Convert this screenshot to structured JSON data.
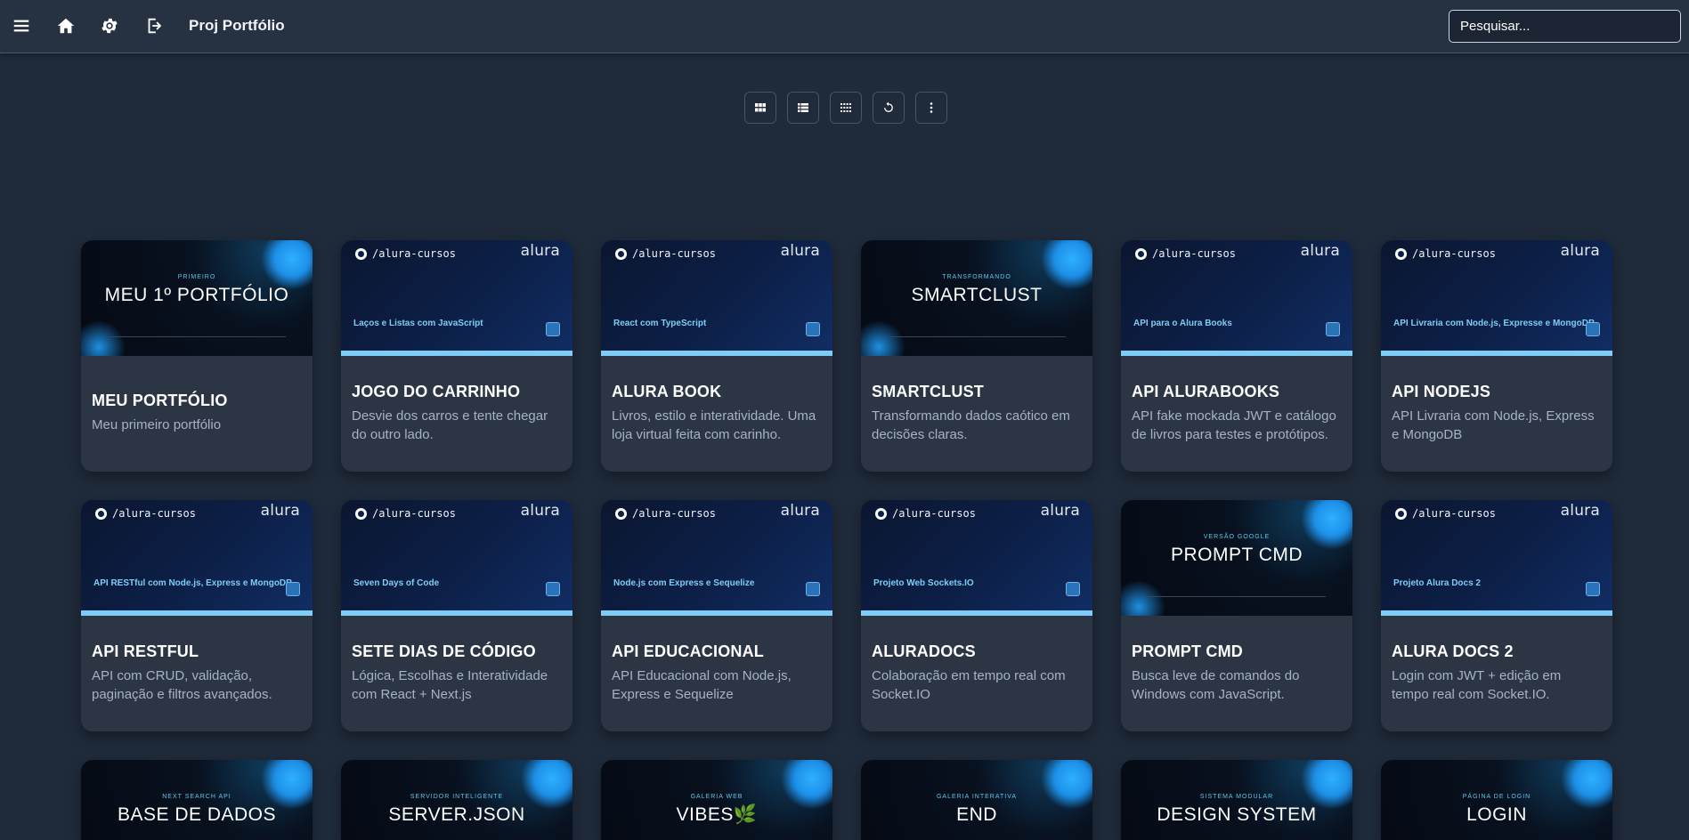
{
  "header": {
    "title": "Proj Portfólio",
    "icons": [
      "menu-icon",
      "home-icon",
      "settings-icon",
      "logout-icon"
    ],
    "search_placeholder": "Pesquisar..."
  },
  "toolbar": {
    "buttons": [
      "grid-view-icon",
      "list-view-icon",
      "compact-grid-icon",
      "refresh-icon",
      "more-options-icon"
    ]
  },
  "colors": {
    "background": "#1f2a3a",
    "card": "#2b3544",
    "accent": "#7ecdf6"
  },
  "cards": [
    {
      "name": "MEU PORTFÓLIO",
      "desc": "Meu primeiro portfólio",
      "thumb": {
        "type": "dark",
        "eyebrow": "PRIMEIRO",
        "title": "MEU 1º PORTFÓLIO"
      }
    },
    {
      "name": "JOGO DO CARRINHO",
      "desc": "Desvie dos carros e tente chegar do outro lado.",
      "thumb": {
        "type": "gh",
        "handle": "/alura-cursos",
        "logo": "alura",
        "course": "Laços e Listas com JavaScript"
      }
    },
    {
      "name": "ALURA BOOK",
      "desc": "Livros, estilo e interatividade. Uma loja virtual feita com carinho.",
      "thumb": {
        "type": "gh",
        "handle": "/alura-cursos",
        "logo": "alura",
        "course": "React com TypeScript"
      }
    },
    {
      "name": "SMARTCLUST",
      "desc": "Transformando dados caótico em decisões claras.",
      "thumb": {
        "type": "dark",
        "eyebrow": "TRANSFORMANDO",
        "title": "SMARTCLUST"
      }
    },
    {
      "name": "API ALURABOOKS",
      "desc": "API fake mockada JWT e catálogo de livros para testes e protótipos.",
      "thumb": {
        "type": "gh",
        "handle": "/alura-cursos",
        "logo": "alura",
        "course": "API para o Alura Books"
      }
    },
    {
      "name": "API NODEJS",
      "desc": "API Livraria com Node.js, Express e MongoDB",
      "thumb": {
        "type": "gh",
        "handle": "/alura-cursos",
        "logo": "alura",
        "course": "API Livraria com Node.js, Expresse e MongoDB"
      }
    },
    {
      "name": "API RESTFUL",
      "desc": "API com CRUD, validação, paginação e filtros avançados.",
      "thumb": {
        "type": "gh",
        "handle": "/alura-cursos",
        "logo": "alura",
        "course": "API RESTful com Node.js, Express e MongoDB"
      }
    },
    {
      "name": "SETE DIAS DE CÓDIGO",
      "desc": "Lógica, Escolhas e Interatividade com React + Next.js",
      "thumb": {
        "type": "gh",
        "handle": "/alura-cursos",
        "logo": "alura",
        "course": "Seven Days of Code"
      }
    },
    {
      "name": "API EDUCACIONAL",
      "desc": "API Educacional com Node.js, Express e Sequelize",
      "thumb": {
        "type": "gh",
        "handle": "/alura-cursos",
        "logo": "alura",
        "course": "Node.js com Express e Sequelize"
      }
    },
    {
      "name": "ALURADOCS",
      "desc": "Colaboração em tempo real com Socket.IO",
      "thumb": {
        "type": "gh",
        "handle": "/alura-cursos",
        "logo": "alura",
        "course": "Projeto Web Sockets.IO"
      }
    },
    {
      "name": "PROMPT CMD",
      "desc": "Busca leve de comandos do Windows com JavaScript.",
      "thumb": {
        "type": "dark",
        "eyebrow": "VERSÃO GOOGLE",
        "title": "PROMPT CMD"
      }
    },
    {
      "name": "ALURA DOCS 2",
      "desc": "Login com JWT + edição em tempo real com Socket.IO.",
      "thumb": {
        "type": "gh",
        "handle": "/alura-cursos",
        "logo": "alura",
        "course": "Projeto Alura Docs 2"
      }
    }
  ],
  "partial_cards": [
    {
      "eyebrow": "NEXT SEARCH API",
      "title": "BASE DE DADOS"
    },
    {
      "eyebrow": "SERVIDOR INTELIGENTE",
      "title": "SERVER.JSON"
    },
    {
      "eyebrow": "GALERIA WEB",
      "title": "VIBES🌿"
    },
    {
      "eyebrow": "GALERIA INTERATIVA",
      "title": "END"
    },
    {
      "eyebrow": "SISTEMA MODULAR",
      "title": "DESIGN SYSTEM"
    },
    {
      "eyebrow": "PÁGINA DE LOGIN",
      "title": "LOGIN"
    }
  ]
}
